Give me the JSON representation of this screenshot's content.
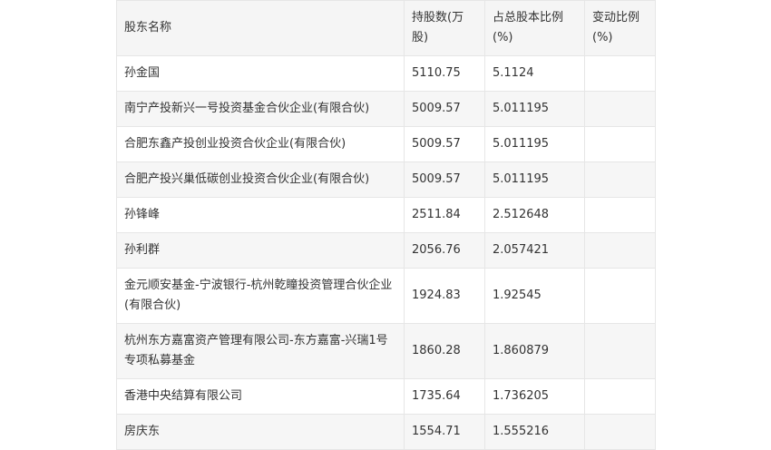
{
  "table": {
    "headers": [
      "股东名称",
      "持股数(万股)",
      "占总股本比例(%)",
      "变动比例(%)"
    ],
    "rows": [
      [
        "孙金国",
        "5110.75",
        "5.1124",
        ""
      ],
      [
        "南宁产投新兴一号投资基金合伙企业(有限合伙)",
        "5009.57",
        "5.011195",
        ""
      ],
      [
        "合肥东鑫产投创业投资合伙企业(有限合伙)",
        "5009.57",
        "5.011195",
        ""
      ],
      [
        "合肥产投兴巢低碳创业投资合伙企业(有限合伙)",
        "5009.57",
        "5.011195",
        ""
      ],
      [
        "孙锋峰",
        "2511.84",
        "2.512648",
        ""
      ],
      [
        "孙利群",
        "2056.76",
        "2.057421",
        ""
      ],
      [
        "金元顺安基金-宁波银行-杭州乾瞳投资管理合伙企业(有限合伙)",
        "1924.83",
        "1.92545",
        ""
      ],
      [
        "杭州东方嘉富资产管理有限公司-东方嘉富-兴瑞1号专项私募基金",
        "1860.28",
        "1.860879",
        ""
      ],
      [
        "香港中央结算有限公司",
        "1735.64",
        "1.736205",
        ""
      ],
      [
        "房庆东",
        "1554.71",
        "1.555216",
        ""
      ]
    ]
  }
}
